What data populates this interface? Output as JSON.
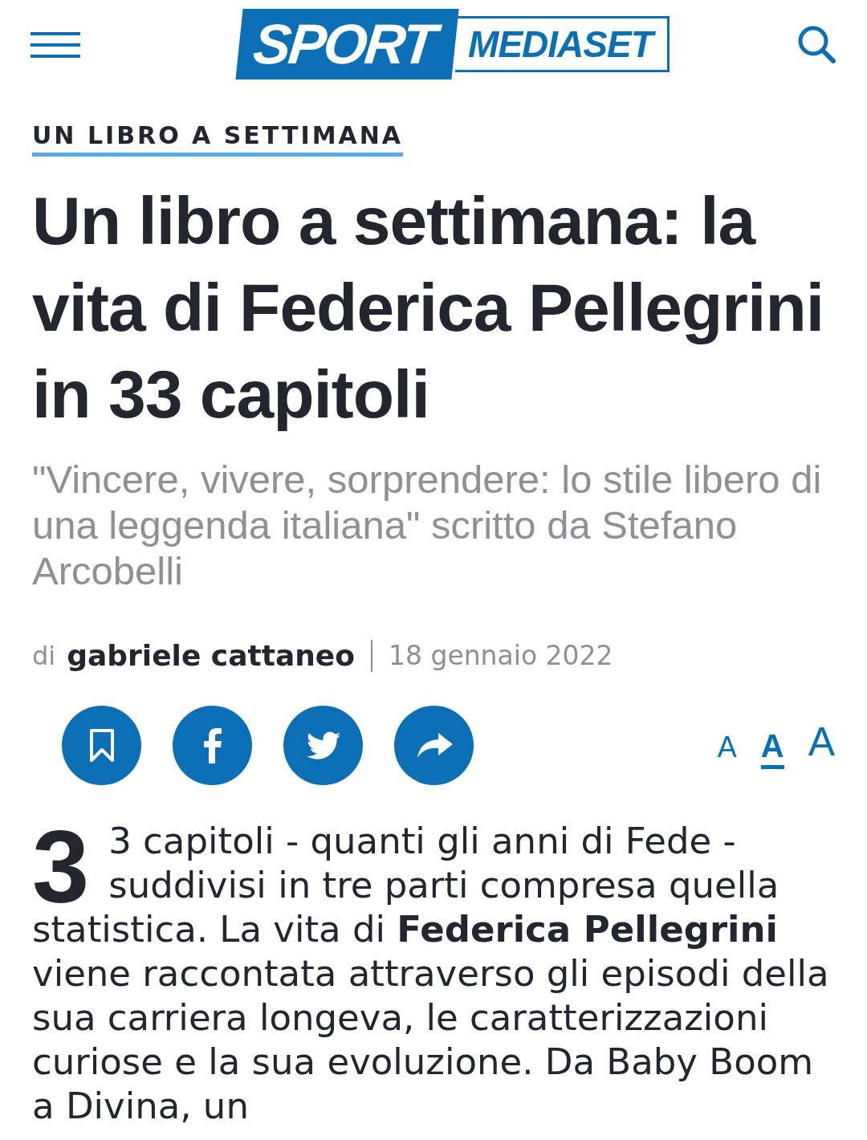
{
  "header": {
    "logo": {
      "sport": "SPORT",
      "mediaset": "MEDIASET"
    }
  },
  "section_label": "UN LIBRO A SETTIMANA",
  "title": "Un libro a settimana: la vita di Federica Pellegrini in 33 capitoli",
  "subtitle": "\"Vincere, vivere, sorprendere: lo stile libero di una leggenda italiana\" scritto da Stefano Arcobelli",
  "byline": {
    "prefix": "di",
    "author": "gabriele cattaneo",
    "date": "18 gennaio 2022"
  },
  "share_buttons": [
    {
      "kind": "bookmark"
    },
    {
      "kind": "facebook"
    },
    {
      "kind": "twitter"
    },
    {
      "kind": "share"
    }
  ],
  "font_sizes": [
    {
      "label": "A",
      "selected": false
    },
    {
      "label": "A",
      "selected": true
    },
    {
      "label": "A",
      "selected": false
    }
  ],
  "body": {
    "drop_cap": "3",
    "text": "3 capitoli - quanti gli anni di Fede - suddivisi in tre parti compresa quella statistica. La vita di **Federica Pellegrini** viene raccontata attraverso gli episodi della sua carriera longeva, le caratterizzazioni curiose e la sua evoluzione. Da Baby Boom a Divina, un"
  }
}
